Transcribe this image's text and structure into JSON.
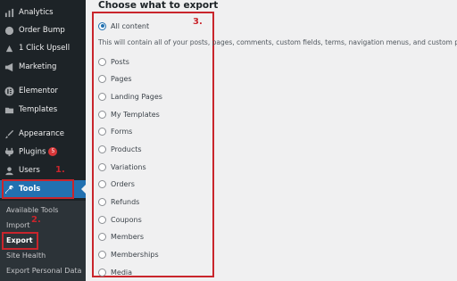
{
  "sidebar": {
    "items": [
      {
        "label": "Analytics",
        "icon": "analytics-icon"
      },
      {
        "label": "Order Bump",
        "icon": "order-bump-icon"
      },
      {
        "label": "1 Click Upsell",
        "icon": "upsell-icon"
      },
      {
        "label": "Marketing",
        "icon": "megaphone-icon"
      },
      {
        "label": "Elementor",
        "icon": "elementor-icon"
      },
      {
        "label": "Templates",
        "icon": "folder-icon"
      },
      {
        "label": "Appearance",
        "icon": "brush-icon"
      },
      {
        "label": "Plugins",
        "icon": "plug-icon",
        "badge": "5"
      },
      {
        "label": "Users",
        "icon": "user-icon"
      },
      {
        "label": "Tools",
        "icon": "wrench-icon",
        "active": true
      }
    ],
    "submenu": [
      "Available Tools",
      "Import",
      "Export",
      "Site Health",
      "Export Personal Data"
    ],
    "current_submenu": "Export"
  },
  "annotations": {
    "one": "1.",
    "two": "2.",
    "three": "3."
  },
  "main": {
    "heading": "Choose what to export",
    "description": "This will contain all of your posts, pages, comments, custom fields, terms, navigation menus, and custom posts.",
    "options": [
      {
        "label": "All content",
        "checked": true
      },
      {
        "label": "Posts"
      },
      {
        "label": "Pages"
      },
      {
        "label": "Landing Pages"
      },
      {
        "label": "My Templates"
      },
      {
        "label": "Forms"
      },
      {
        "label": "Products"
      },
      {
        "label": "Variations"
      },
      {
        "label": "Orders"
      },
      {
        "label": "Refunds"
      },
      {
        "label": "Coupons"
      },
      {
        "label": "Members"
      },
      {
        "label": "Memberships"
      },
      {
        "label": "Media"
      }
    ]
  },
  "colors": {
    "sidebar_bg": "#1d2327",
    "active_bg": "#2271b1",
    "annotation": "#c9252c",
    "badge": "#d63638"
  }
}
